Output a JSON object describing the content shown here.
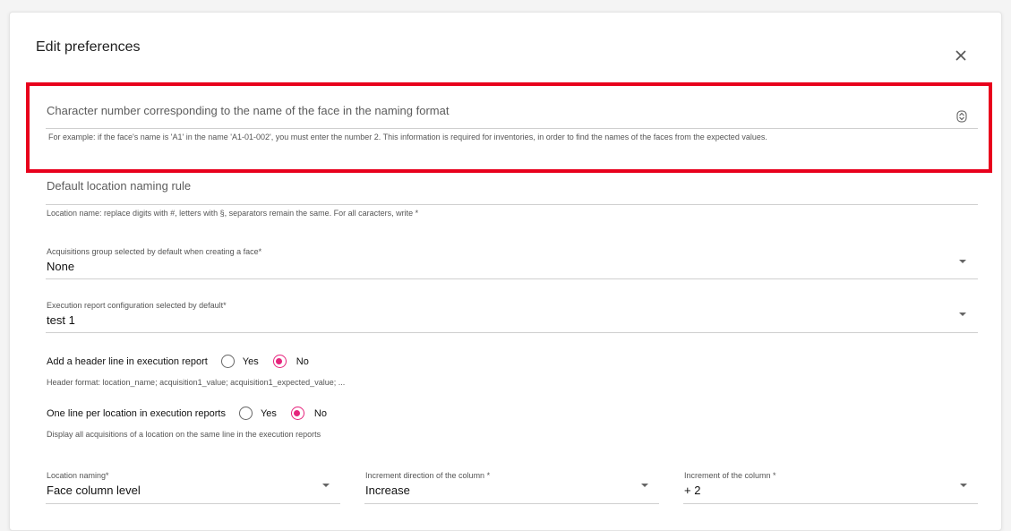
{
  "dialog": {
    "title": "Edit preferences",
    "close_icon": "close-icon"
  },
  "char_number_field": {
    "placeholder": "Character number corresponding to the name of the face in the naming format",
    "helper": "For example: if the face's name is 'A1' in the name 'A1-01-002', you must enter the number 2. This information is required for inventories, in order to find the names of the faces from the expected values.",
    "icon": "stepper-icon"
  },
  "naming_rule_field": {
    "placeholder": "Default location naming rule",
    "helper": "Location name: replace digits with #, letters with §, separators remain the same. For all caracters, write *"
  },
  "acquisitions_group": {
    "label": "Acquisitions group selected by default when creating a face*",
    "value": "None"
  },
  "execution_report_config": {
    "label": "Execution report configuration selected by default*",
    "value": "test 1"
  },
  "header_line": {
    "label": "Add a header line in execution report",
    "yes": "Yes",
    "no": "No",
    "selected": "No",
    "helper": "Header format: location_name; acquisition1_value; acquisition1_expected_value; ..."
  },
  "one_line_per_location": {
    "label": "One line per location in execution reports",
    "yes": "Yes",
    "no": "No",
    "selected": "No",
    "helper": "Display all acquisitions of a location on the same line in the execution reports"
  },
  "location_naming": {
    "label": "Location naming*",
    "value": "Face column level"
  },
  "increment_direction": {
    "label": "Increment direction of the column *",
    "value": "Increase"
  },
  "increment_column": {
    "label": "Increment of the column *",
    "value": "+ 2"
  },
  "colors": {
    "highlight": "#e8001c",
    "radio_accent": "#e6237c"
  }
}
